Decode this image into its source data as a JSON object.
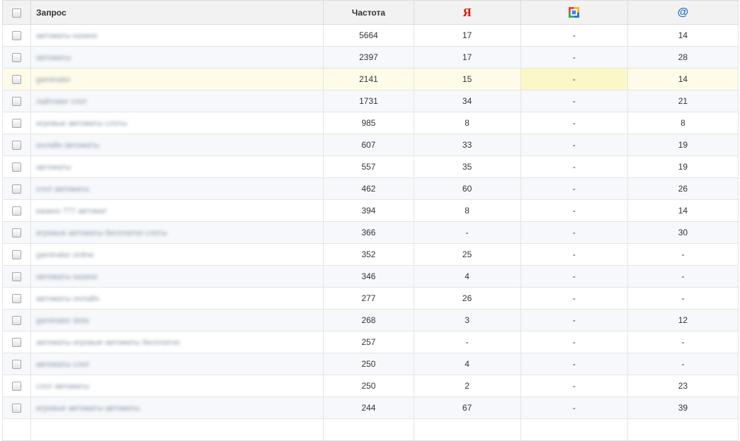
{
  "header": {
    "query_label": "Запрос",
    "freq_label": "Частота",
    "sort_arrow": "↑",
    "yandex_icon": "Я",
    "mail_icon": "@",
    "google_icon": "google-icon"
  },
  "rows": [
    {
      "q": "автоматы казино",
      "freq": "5664",
      "ya": "17",
      "g": "-",
      "mail": "14"
    },
    {
      "q": "автоматы",
      "freq": "2397",
      "ya": "17",
      "g": "-",
      "mail": "28"
    },
    {
      "q": "gaminator",
      "freq": "2141",
      "ya": "15",
      "g": "-",
      "mail": "14"
    },
    {
      "q": "лайтнинг слот",
      "freq": "1731",
      "ya": "34",
      "g": "-",
      "mail": "21"
    },
    {
      "q": "игровые автоматы слоты",
      "freq": "985",
      "ya": "8",
      "g": "-",
      "mail": "8"
    },
    {
      "q": "онлайн автоматы",
      "freq": "607",
      "ya": "33",
      "g": "-",
      "mail": "19"
    },
    {
      "q": "автоматы",
      "freq": "557",
      "ya": "35",
      "g": "-",
      "mail": "19"
    },
    {
      "q": "слот автоматы",
      "freq": "462",
      "ya": "60",
      "g": "-",
      "mail": "26"
    },
    {
      "q": "казино 777 автомат",
      "freq": "394",
      "ya": "8",
      "g": "-",
      "mail": "14"
    },
    {
      "q": "игровые автоматы бесплатно слоты",
      "freq": "366",
      "ya": "-",
      "g": "-",
      "mail": "30"
    },
    {
      "q": "gaminator online",
      "freq": "352",
      "ya": "25",
      "g": "-",
      "mail": "-"
    },
    {
      "q": "автоматы казино",
      "freq": "346",
      "ya": "4",
      "g": "-",
      "mail": "-"
    },
    {
      "q": "автоматы онлайн",
      "freq": "277",
      "ya": "26",
      "g": "-",
      "mail": "-"
    },
    {
      "q": "gaminator slots",
      "freq": "268",
      "ya": "3",
      "g": "-",
      "mail": "12"
    },
    {
      "q": "автоматы игровые автоматы бесплатно",
      "freq": "257",
      "ya": "-",
      "g": "-",
      "mail": "-"
    },
    {
      "q": "автоматы слот",
      "freq": "250",
      "ya": "4",
      "g": "-",
      "mail": "-"
    },
    {
      "q": "слот автоматы",
      "freq": "250",
      "ya": "2",
      "g": "-",
      "mail": "23"
    },
    {
      "q": "игровые автоматы автоматы",
      "freq": "244",
      "ya": "67",
      "g": "-",
      "mail": "39"
    },
    {
      "q": "",
      "freq": "",
      "ya": "",
      "g": "",
      "mail": ""
    }
  ],
  "highlight_color": "#fefce8",
  "highlight_cell_color": "#fcf7c6"
}
